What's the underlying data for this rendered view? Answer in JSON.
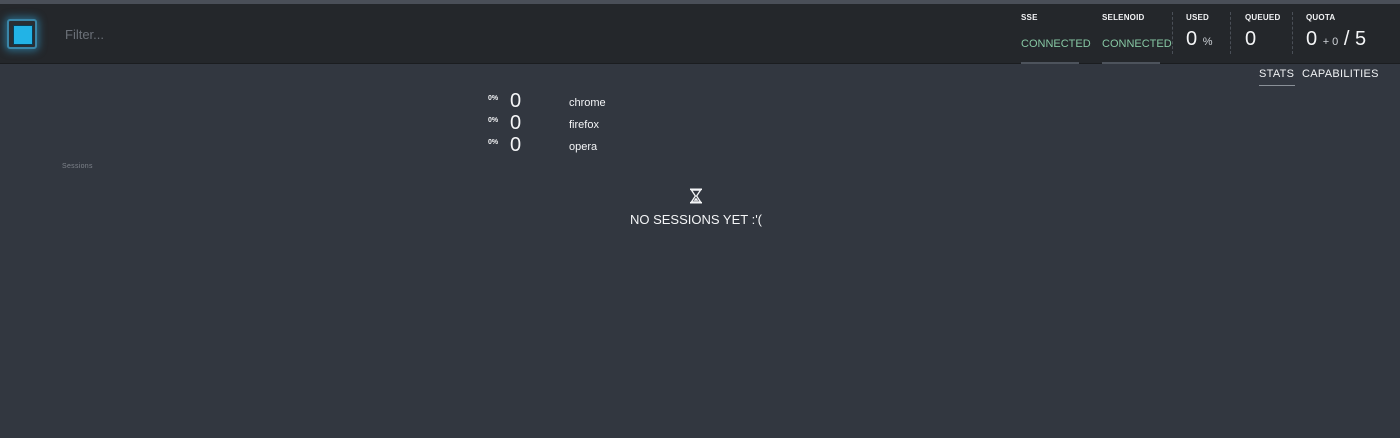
{
  "header": {
    "logo": {
      "icon": "selenoid-ui-logo-icon",
      "accent": "#22b3e6"
    },
    "filter": {
      "placeholder": "Filter..."
    },
    "status": [
      {
        "label": "SSE",
        "value": "CONNECTED"
      },
      {
        "label": "SELENOID",
        "value": "CONNECTED"
      }
    ],
    "counters": {
      "used": {
        "label": "USED",
        "value": "0",
        "unit": "%"
      },
      "queued": {
        "label": "QUEUED",
        "value": "0"
      },
      "quota": {
        "label": "QUOTA",
        "value": "0",
        "pending": "+ 0",
        "separator": "/",
        "total": "5"
      }
    }
  },
  "tabs": [
    {
      "label": "STATS",
      "active": true
    },
    {
      "label": "CAPABILITIES",
      "active": false
    }
  ],
  "stats": [
    {
      "percent": "0%",
      "count": "0",
      "browser": "chrome"
    },
    {
      "percent": "0%",
      "count": "0",
      "browser": "firefox"
    },
    {
      "percent": "0%",
      "count": "0",
      "browser": "opera"
    }
  ],
  "sessions": {
    "label": "Sessions",
    "empty_icon": "hourglass-icon",
    "empty_message": "NO SESSIONS YET :'("
  },
  "colors": {
    "background": "#323740",
    "header": "#24272b",
    "connected": "#86c7a3"
  }
}
